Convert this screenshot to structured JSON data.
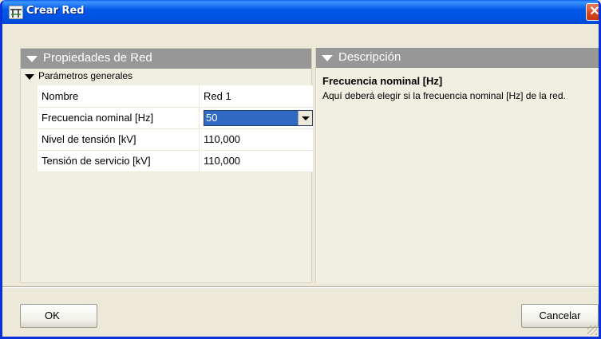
{
  "window": {
    "title": "Crear Red"
  },
  "properties_panel": {
    "header": "Propiedades de Red",
    "group": "Parámetros generales",
    "rows": [
      {
        "name": "Nombre",
        "value": "Red 1"
      },
      {
        "name": "Frecuencia nominal [Hz]",
        "value": "50"
      },
      {
        "name": "Nivel de tensión [kV]",
        "value": "110,000"
      },
      {
        "name": "Tensión de servicio [kV]",
        "value": "110,000"
      }
    ]
  },
  "description_panel": {
    "header": "Descripción",
    "title": "Frecuencia nominal [Hz]",
    "text": "Aquí deberá elegir si la frecuencia nominal [Hz] de la red."
  },
  "buttons": {
    "ok": "OK",
    "cancel": "Cancelar"
  },
  "colors": {
    "titlebar": "#0054e3",
    "panel_header": "#979797",
    "selection": "#316ac5"
  }
}
